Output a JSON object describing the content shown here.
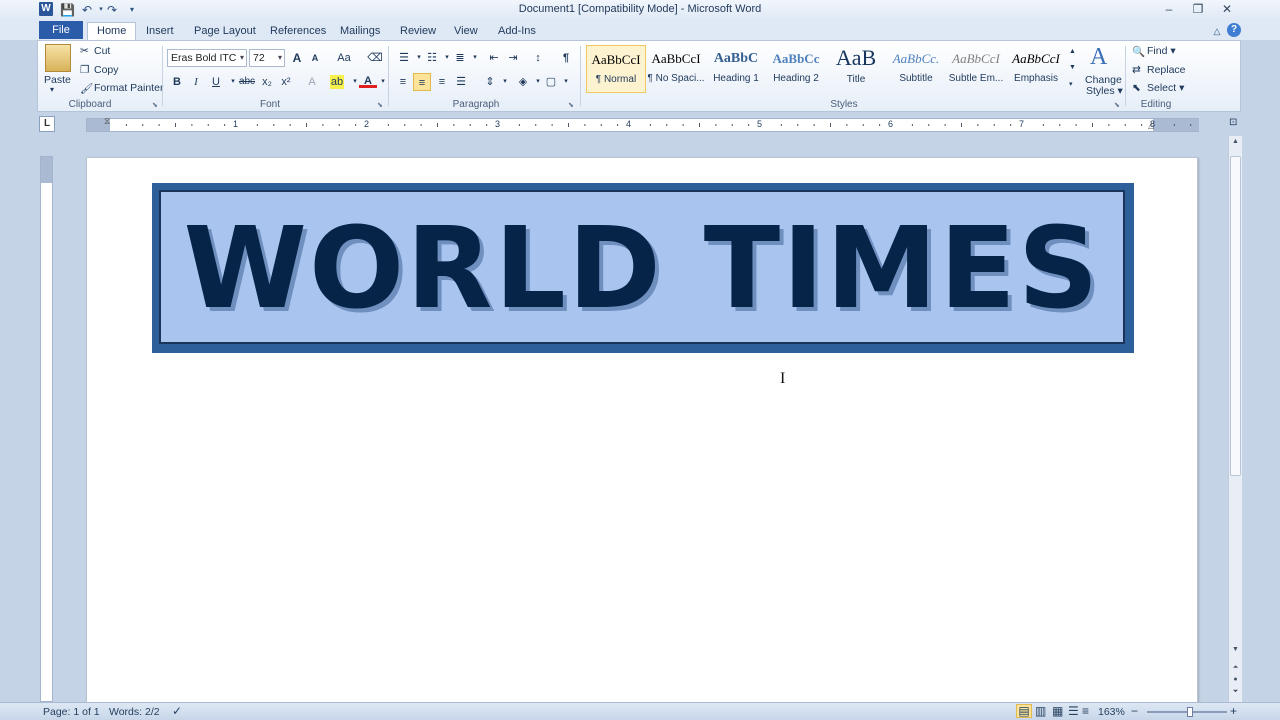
{
  "window": {
    "title": "Document1 [Compatibility Mode] - Microsoft Word",
    "app_icon_letter": "W",
    "minimize": "–",
    "restore": "❐",
    "close": "✕"
  },
  "tabs": {
    "file": "File",
    "home": "Home",
    "insert": "Insert",
    "page_layout": "Page Layout",
    "references": "References",
    "mailings": "Mailings",
    "review": "Review",
    "view": "View",
    "add_ins": "Add-Ins"
  },
  "clipboard": {
    "paste": "Paste",
    "cut": "Cut",
    "copy": "Copy",
    "format_painter": "Format Painter",
    "label": "Clipboard"
  },
  "font": {
    "name": "Eras Bold ITC",
    "size": "72",
    "label": "Font",
    "bold": "B",
    "italic": "I",
    "underline": "U",
    "strike": "abc",
    "subscript": "x₂",
    "superscript": "x²",
    "grow": "A",
    "shrink": "A",
    "change_case": "Aa",
    "text_color": "A"
  },
  "paragraph": {
    "label": "Paragraph",
    "pilcrow": "¶"
  },
  "styles": {
    "label": "Styles",
    "items": [
      {
        "sample": "AaBbCcI",
        "name": "¶ Normal"
      },
      {
        "sample": "AaBbCcI",
        "name": "¶ No Spaci..."
      },
      {
        "sample": "AaBbC",
        "name": "Heading 1"
      },
      {
        "sample": "AaBbCc",
        "name": "Heading 2"
      },
      {
        "sample": "AaB",
        "name": "Title"
      },
      {
        "sample": "AaBbCc.",
        "name": "Subtitle"
      },
      {
        "sample": "AaBbCcI",
        "name": "Subtle Em..."
      },
      {
        "sample": "AaBbCcI",
        "name": "Emphasis"
      }
    ],
    "change_styles_line1": "Change",
    "change_styles_line2": "Styles ▾"
  },
  "editing": {
    "find": "Find ▾",
    "replace": "Replace",
    "select": "Select ▾",
    "label": "Editing"
  },
  "ruler": {
    "corner": "L",
    "numbers": [
      "1",
      "2",
      "3",
      "4",
      "5",
      "6",
      "7",
      "8"
    ]
  },
  "document": {
    "banner_text": "WORLD TIMES"
  },
  "status": {
    "page": "Page: 1 of 1",
    "words": "Words: 2/2",
    "zoom": "163%",
    "zoom_out": "−",
    "zoom_in": "+"
  },
  "colors": {
    "banner_border": "#2d5f9a",
    "banner_fill": "#a9c5ef",
    "banner_text": "#062447",
    "file_tab": "#2a5ca9"
  }
}
